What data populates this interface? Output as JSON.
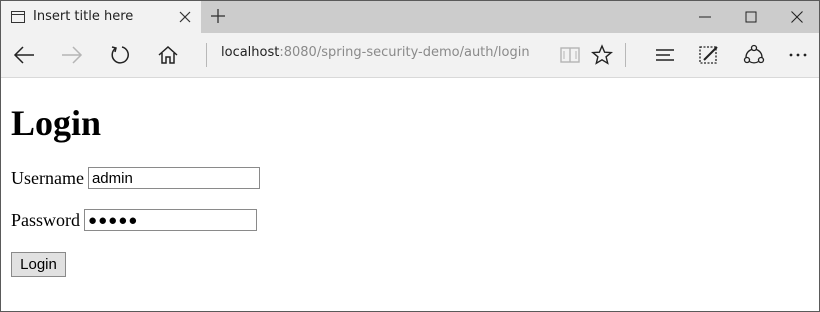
{
  "browser": {
    "tab_title": "Insert title here",
    "address_host": "localhost",
    "address_path": ":8080/spring-security-demo/auth/login",
    "icons": {
      "tab_page": "page-icon",
      "tab_close": "close-icon",
      "new_tab": "plus-icon",
      "minimize": "minimize-icon",
      "maximize": "maximize-icon",
      "close": "close-icon",
      "back": "back-arrow-icon",
      "forward": "forward-arrow-icon",
      "refresh": "refresh-icon",
      "home": "home-icon",
      "reading_view": "book-icon",
      "favorite": "star-icon",
      "hub": "hub-lines-icon",
      "web_note": "pen-note-icon",
      "share": "share-icon",
      "more": "more-dots-icon"
    }
  },
  "page": {
    "title": "Login",
    "username_label": "Username",
    "username_value": "admin",
    "password_label": "Password",
    "password_value": "●●●●●",
    "login_button": "Login"
  },
  "colors": {
    "titlebar": "#cccccc",
    "tab_active": "#f2f2f2",
    "toolbar": "#f2f2f2",
    "address_path": "#8a8a8a"
  }
}
